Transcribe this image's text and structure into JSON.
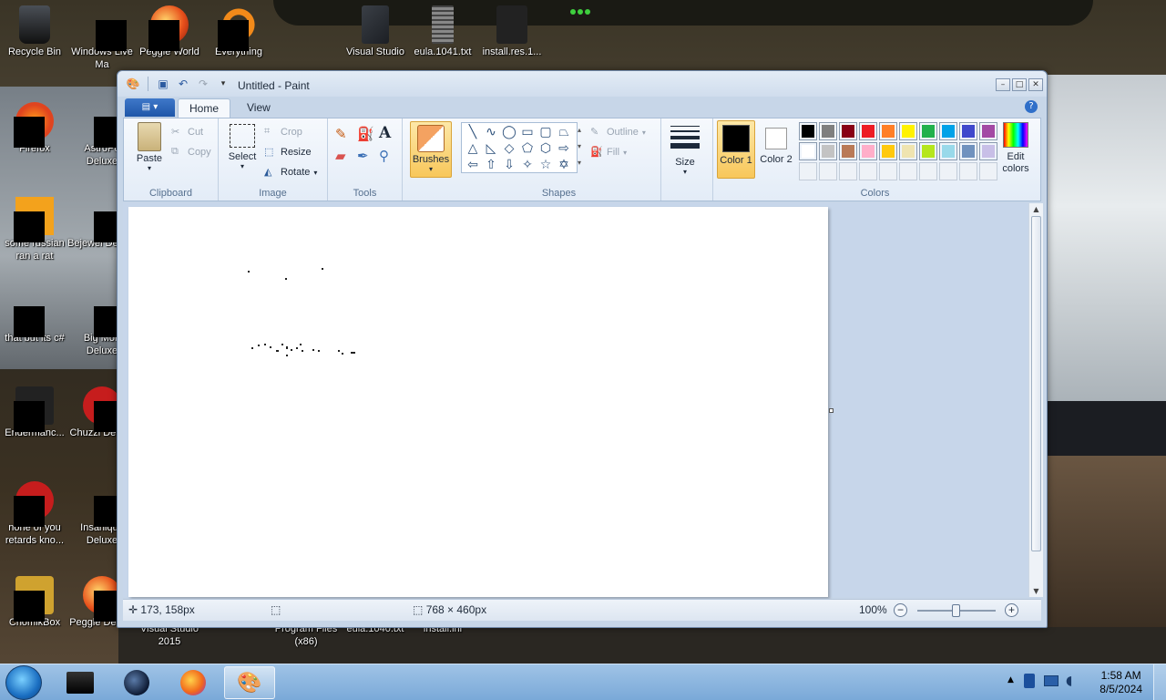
{
  "desktop": {
    "icons": [
      {
        "label": "Recycle Bin"
      },
      {
        "label": "Windows Live Ma"
      },
      {
        "label": "Peggle World"
      },
      {
        "label": "Everything"
      },
      {
        "label": "Visual Studio"
      },
      {
        "label": "eula.1041.txt"
      },
      {
        "label": "install.res.1..."
      },
      {
        "label": "Firefox"
      },
      {
        "label": "AstroPo Deluxe"
      },
      {
        "label": "some russian ran a rat"
      },
      {
        "label": "Bejewel Deluxe"
      },
      {
        "label": "that but its c#"
      },
      {
        "label": "Big Mon Deluxe"
      },
      {
        "label": "Endermanc..."
      },
      {
        "label": "Chuzzl Deluxe"
      },
      {
        "label": "none of you retards kno..."
      },
      {
        "label": "Insaniqua Deluxe"
      },
      {
        "label": "ChomikBox"
      },
      {
        "label": "Peggle Deluxe"
      },
      {
        "label": "Visual Studio 2015"
      },
      {
        "label": "Program Files (x86)"
      },
      {
        "label": "eula.1040.txt"
      },
      {
        "label": "install.ini"
      }
    ]
  },
  "window": {
    "title": "Untitled - Paint",
    "tabs": {
      "home": "Home",
      "view": "View"
    },
    "ribbon": {
      "clipboard": {
        "label": "Clipboard",
        "paste": "Paste",
        "cut": "Cut",
        "copy": "Copy"
      },
      "image": {
        "label": "Image",
        "select": "Select",
        "crop": "Crop",
        "resize": "Resize",
        "rotate": "Rotate"
      },
      "tools": {
        "label": "Tools"
      },
      "brushes": {
        "label": "Brushes"
      },
      "shapes": {
        "label": "Shapes",
        "outline": "Outline",
        "fill": "Fill"
      },
      "size": {
        "label": "Size"
      },
      "colors": {
        "label": "Colors",
        "color1": "Color 1",
        "color2": "Color 2",
        "edit": "Edit colors",
        "palette_row1": [
          "#000000",
          "#7f7f7f",
          "#880015",
          "#ed1c24",
          "#ff7f27",
          "#fff200",
          "#22b14c",
          "#00a2e8",
          "#3f48cc",
          "#a349a4"
        ],
        "palette_row2": [
          "#ffffff",
          "#c3c3c3",
          "#b97a57",
          "#ffaec9",
          "#ffc90e",
          "#efe4b0",
          "#b5e61d",
          "#99d9ea",
          "#7092be",
          "#c8bfe7"
        ],
        "color1_value": "#000000",
        "color2_value": "#ffffff"
      }
    },
    "status": {
      "cursor_pos": "173, 158px",
      "selection_size": "",
      "image_size": "768 × 460px",
      "zoom": "100%"
    }
  },
  "taskbar": {
    "time": "1:58 AM",
    "date": "8/5/2024"
  }
}
